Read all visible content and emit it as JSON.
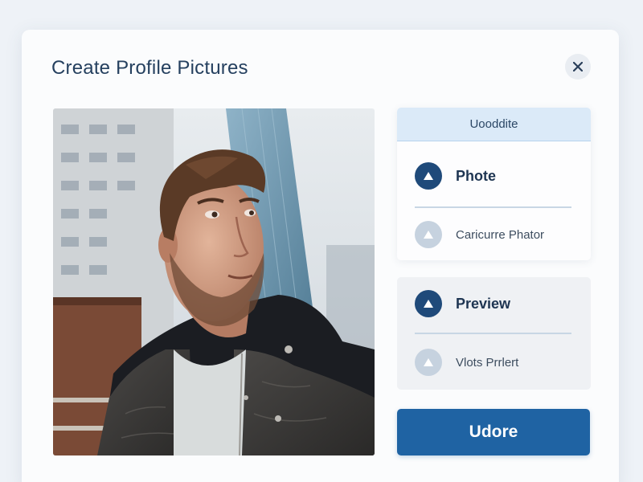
{
  "dialog": {
    "title": "Create Profile Pictures",
    "close_icon": "close-icon"
  },
  "photo": {
    "subject": "profile-photo"
  },
  "upload_card": {
    "header": "Uooddite",
    "items": [
      {
        "label": "Phote",
        "icon": "triangle-up-icon",
        "emphasis": true
      },
      {
        "label": "Caricurre Phator",
        "icon": "triangle-up-icon",
        "emphasis": false
      }
    ]
  },
  "preview_card": {
    "items": [
      {
        "label": "Preview",
        "icon": "triangle-up-icon",
        "emphasis": true
      },
      {
        "label": "Vlots Prrlert",
        "icon": "triangle-up-icon",
        "emphasis": false
      }
    ]
  },
  "primary_button": {
    "label": "Udore"
  },
  "colors": {
    "page_bg": "#eef2f7",
    "accent": "#1f63a3",
    "icon_dark": "#1f4a7a",
    "icon_light": "#c6d2df",
    "header_bg": "#dbeaf8"
  }
}
